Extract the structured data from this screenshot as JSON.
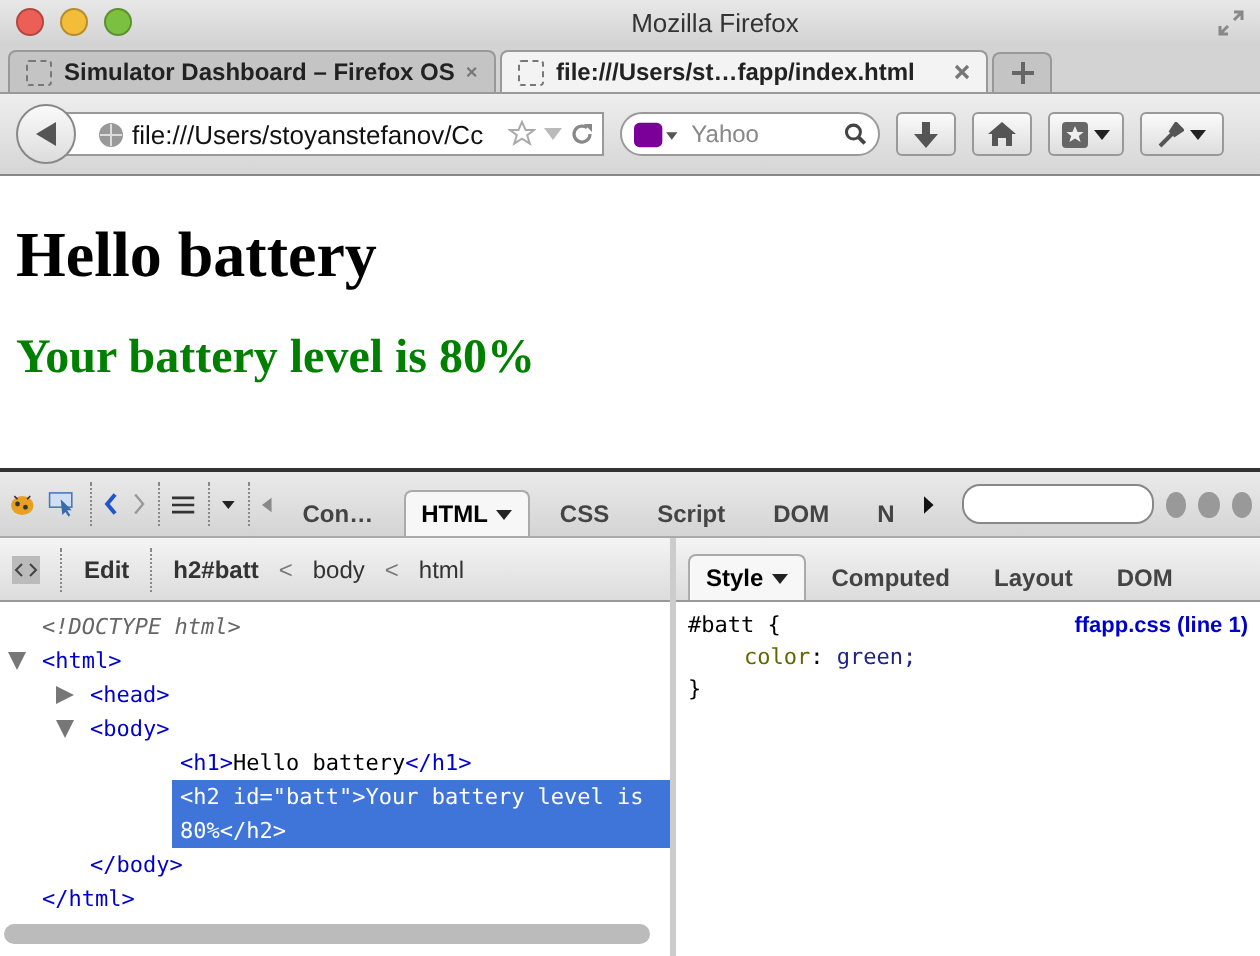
{
  "window": {
    "title": "Mozilla Firefox"
  },
  "tabs": [
    {
      "label": "Simulator Dashboard – Firefox OS",
      "selected": false
    },
    {
      "label": "file:///Users/st…fapp/index.html",
      "selected": true
    }
  ],
  "address_bar": {
    "value": "file:///Users/stoyanstefanov/Cc"
  },
  "search": {
    "placeholder": "Yahoo"
  },
  "page": {
    "heading": "Hello battery",
    "subheading": "Your battery level is 80%"
  },
  "firebug": {
    "panels": [
      {
        "label": "Con…",
        "selected": false,
        "menu": false
      },
      {
        "label": "HTML",
        "selected": true,
        "menu": true
      },
      {
        "label": "CSS",
        "selected": false,
        "menu": false
      },
      {
        "label": "Script",
        "selected": false,
        "menu": false
      },
      {
        "label": "DOM",
        "selected": false,
        "menu": false
      },
      {
        "label": "N",
        "selected": false,
        "menu": false
      }
    ],
    "edit_label": "Edit",
    "breadcrumbs": [
      "h2#batt",
      "body",
      "html"
    ],
    "breadcrumb_separator": "<",
    "tree": [
      {
        "kind": "doctype",
        "label": "<!DOCTYPE html>"
      },
      {
        "kind": "element",
        "label": "<html>",
        "expanded": true,
        "closing": "</html>",
        "children": [
          {
            "kind": "element",
            "label": "<head>",
            "expanded": false
          },
          {
            "kind": "element",
            "label": "<body>",
            "expanded": true,
            "closing": "</body>",
            "children": [
              {
                "kind": "leaf",
                "open": "<h1>",
                "text": "Hello battery",
                "close": "</h1>",
                "selected": false
              },
              {
                "kind": "leaf",
                "open": "<h2 id=\"batt\">",
                "text": "Your battery level is 80%",
                "close": "</h2>",
                "selected": true
              }
            ]
          }
        ]
      }
    ],
    "side_tabs": [
      {
        "label": "Style",
        "selected": true,
        "menu": true
      },
      {
        "label": "Computed",
        "selected": false,
        "menu": false
      },
      {
        "label": "Layout",
        "selected": false,
        "menu": false
      },
      {
        "label": "DOM",
        "selected": false,
        "menu": false
      }
    ],
    "rule": {
      "selector": "#batt {",
      "property": "color",
      "separator": ":",
      "value": "green;",
      "close": "}",
      "source": "ffapp.css (line 1)"
    }
  }
}
